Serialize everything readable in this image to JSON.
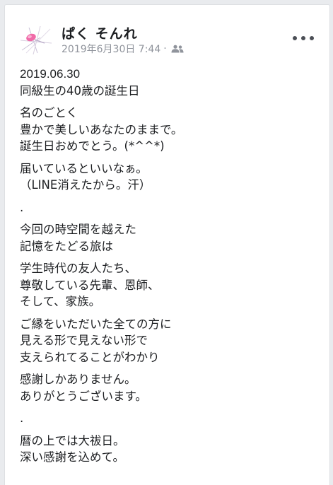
{
  "post": {
    "author": "ぱく そんれ",
    "timestamp": "2019年6月30日 7:44",
    "separator": "·",
    "audience_icon": "friends-icon",
    "more_icon": "more-options-icon",
    "paragraphs": [
      [
        "2019.06.30",
        "同級生の40歳の誕生日"
      ],
      [
        "名のごとく",
        "豊かで美しいあなたのままで。",
        "誕生日おめでとう。(*^^*)"
      ],
      [
        "届いているといいなぁ。",
        "（LINE消えたから。汗）"
      ],
      [
        "."
      ],
      [
        "今回の時空間を越えた",
        "記憶をたどる旅は"
      ],
      [
        "学生時代の友人たち、",
        "尊敬している先輩、恩師、",
        "そして、家族。"
      ],
      [
        "ご縁をいただいた全ての方に",
        "見える形で見えない形で",
        "支えられてることがわかり"
      ],
      [
        "感謝しかありません。",
        "ありがとうございます。"
      ],
      [
        "."
      ],
      [
        "暦の上では大祓日。",
        "深い感謝を込めて。"
      ]
    ]
  },
  "colors": {
    "name_text": "#1c1e21",
    "meta_text": "#90949c",
    "background": "#e9ebee"
  }
}
